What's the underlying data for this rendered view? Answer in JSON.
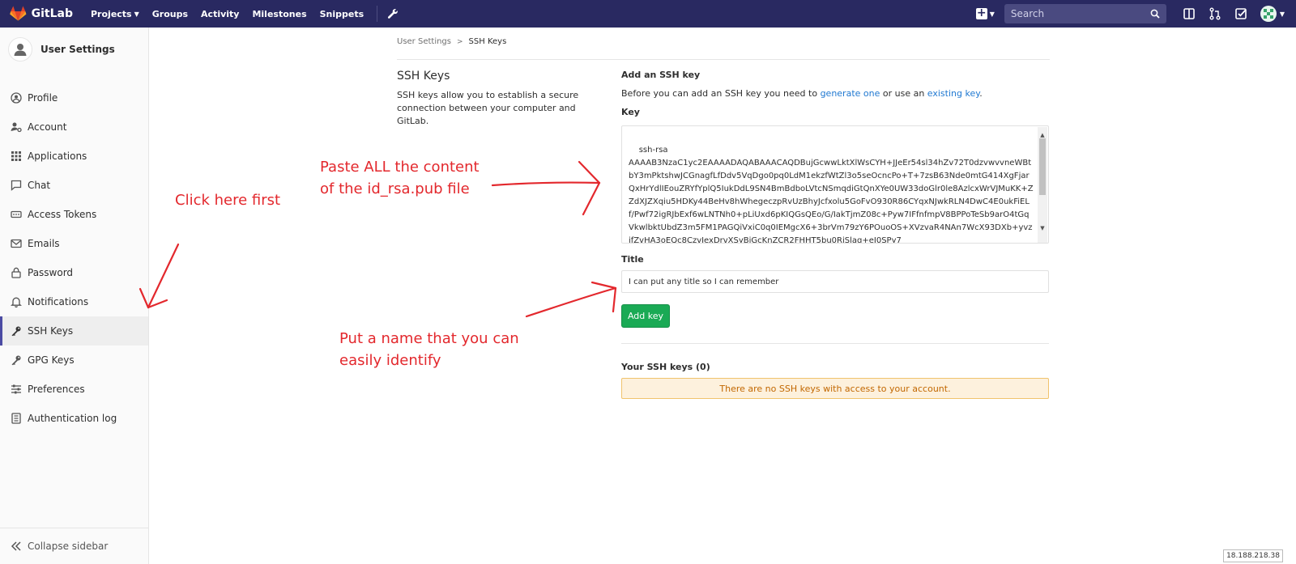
{
  "topbar": {
    "brand": "GitLab",
    "nav": [
      {
        "label": "Projects",
        "has_caret": true
      },
      {
        "label": "Groups"
      },
      {
        "label": "Activity"
      },
      {
        "label": "Milestones"
      },
      {
        "label": "Snippets"
      }
    ],
    "search_placeholder": "Search"
  },
  "sidebar": {
    "title": "User Settings",
    "items": [
      {
        "label": "Profile",
        "icon": "profile-icon"
      },
      {
        "label": "Account",
        "icon": "account-icon"
      },
      {
        "label": "Applications",
        "icon": "applications-icon"
      },
      {
        "label": "Chat",
        "icon": "chat-icon"
      },
      {
        "label": "Access Tokens",
        "icon": "access-tokens-icon"
      },
      {
        "label": "Emails",
        "icon": "emails-icon"
      },
      {
        "label": "Password",
        "icon": "lock-icon"
      },
      {
        "label": "Notifications",
        "icon": "bell-icon"
      },
      {
        "label": "SSH Keys",
        "icon": "key-icon",
        "active": true
      },
      {
        "label": "GPG Keys",
        "icon": "key-icon"
      },
      {
        "label": "Preferences",
        "icon": "preferences-icon"
      },
      {
        "label": "Authentication log",
        "icon": "log-icon"
      }
    ],
    "collapse_label": "Collapse sidebar"
  },
  "breadcrumb": {
    "parent": "User Settings",
    "current": "SSH Keys"
  },
  "section": {
    "title": "SSH Keys",
    "description": "SSH keys allow you to establish a secure connection between your computer and GitLab."
  },
  "form": {
    "heading": "Add an SSH key",
    "intro_before": "Before you can add an SSH key you need to ",
    "intro_link1": "generate one",
    "intro_middle": " or use an ",
    "intro_link2": "existing key",
    "intro_after": ".",
    "key_label": "Key",
    "key_value": "ssh-rsa\nAAAAB3NzaC1yc2EAAAADAQABAAACAQDBujGcwwLktXlWsCYH+JJeEr54sl34hZv72T0dzvwvvneWBtbY3mPktshwJCGnagfLfDdv5VqDgo0pq0LdM1ekzfWtZl3o5seOcncPo+T+7zsB63Nde0mtG414XgFjarQxHrYdlIEouZRYfYplQ5IukDdL9SN4BmBdboLVtcNSmqdiGtQnXYe0UW33doGlr0le8AzlcxWrVJMuKK+ZZdXJZXqiu5HDKy44BeHv8hWhegeczpRvUzBhyJcfxolu5GoFvO930R86CYqxNJwkRLN4DwC4E0ukFiELf/Pwf72igRJbExf6wLNTNh0+pLiUxd6pKIQGsQEo/G/IakTjmZ08c+Pyw7IFfnfmpV8BPPoTeSb9arO4tGqVkwlbktUbdZ3m5FM1PAGQiVxiC0q0IEMgcX6+3brVm79zY6POuoOS+XVzvaR4NAn7WcX93DXb+yvzifZvHA3oEQc8CzvIexDrvXSyBiGcKnZCR2FHHT5bu0RiSlag+eI0SPy7",
    "title_label": "Title",
    "title_value": "I can put any title so I can remember",
    "submit_label": "Add key",
    "keys_heading": "Your SSH keys (0)",
    "empty_message": "There are no SSH keys with access to your account."
  },
  "annotations": {
    "click_here": "Click here first",
    "paste_line1": "Paste ALL the content",
    "paste_line2": "of the id_rsa.pub file",
    "name_line1": "Put a name that you can",
    "name_line2": "easily identify"
  },
  "status": {
    "ip": "18.188.218.38"
  },
  "colors": {
    "topbar": "#292961",
    "accent": "#4b4ba3",
    "link": "#1f78d1",
    "success": "#1aaa55",
    "warning_bg": "#fdf1dd",
    "warning_text": "#c26700",
    "annotation": "#e3282d"
  }
}
